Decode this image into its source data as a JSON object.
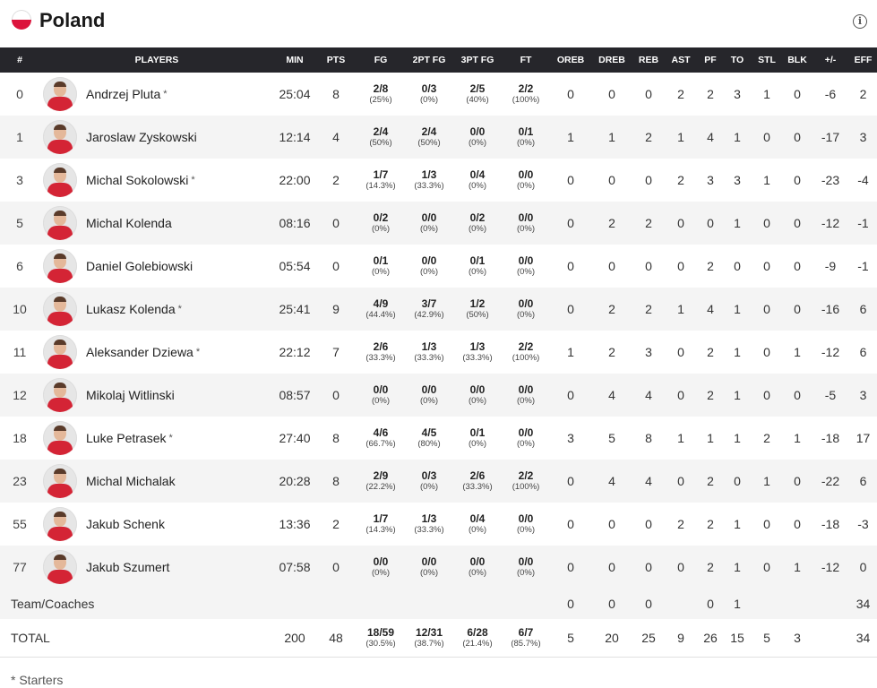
{
  "team_name": "Poland",
  "flag_colors": {
    "top": "#ffffff",
    "bottom": "#dc143c"
  },
  "info_icon": "i",
  "columns": [
    "#",
    "PLAYERS",
    "MIN",
    "PTS",
    "FG",
    "2PT FG",
    "3PT FG",
    "FT",
    "OREB",
    "DREB",
    "REB",
    "AST",
    "PF",
    "TO",
    "STL",
    "BLK",
    "+/-",
    "EFF"
  ],
  "players": [
    {
      "num": "0",
      "name": "Andrzej Pluta",
      "starter": "*",
      "min": "25:04",
      "pts": "8",
      "fg": "2/8",
      "fg_pct": "(25%)",
      "fg2": "0/3",
      "fg2_pct": "(0%)",
      "fg3": "2/5",
      "fg3_pct": "(40%)",
      "ft": "2/2",
      "ft_pct": "(100%)",
      "oreb": "0",
      "dreb": "0",
      "reb": "0",
      "ast": "2",
      "pf": "2",
      "to": "3",
      "stl": "1",
      "blk": "0",
      "pm": "-6",
      "eff": "2"
    },
    {
      "num": "1",
      "name": "Jaroslaw Zyskowski",
      "starter": "",
      "min": "12:14",
      "pts": "4",
      "fg": "2/4",
      "fg_pct": "(50%)",
      "fg2": "2/4",
      "fg2_pct": "(50%)",
      "fg3": "0/0",
      "fg3_pct": "(0%)",
      "ft": "0/1",
      "ft_pct": "(0%)",
      "oreb": "1",
      "dreb": "1",
      "reb": "2",
      "ast": "1",
      "pf": "4",
      "to": "1",
      "stl": "0",
      "blk": "0",
      "pm": "-17",
      "eff": "3"
    },
    {
      "num": "3",
      "name": "Michal Sokolowski",
      "starter": "*",
      "min": "22:00",
      "pts": "2",
      "fg": "1/7",
      "fg_pct": "(14.3%)",
      "fg2": "1/3",
      "fg2_pct": "(33.3%)",
      "fg3": "0/4",
      "fg3_pct": "(0%)",
      "ft": "0/0",
      "ft_pct": "(0%)",
      "oreb": "0",
      "dreb": "0",
      "reb": "0",
      "ast": "2",
      "pf": "3",
      "to": "3",
      "stl": "1",
      "blk": "0",
      "pm": "-23",
      "eff": "-4"
    },
    {
      "num": "5",
      "name": "Michal Kolenda",
      "starter": "",
      "min": "08:16",
      "pts": "0",
      "fg": "0/2",
      "fg_pct": "(0%)",
      "fg2": "0/0",
      "fg2_pct": "(0%)",
      "fg3": "0/2",
      "fg3_pct": "(0%)",
      "ft": "0/0",
      "ft_pct": "(0%)",
      "oreb": "0",
      "dreb": "2",
      "reb": "2",
      "ast": "0",
      "pf": "0",
      "to": "1",
      "stl": "0",
      "blk": "0",
      "pm": "-12",
      "eff": "-1"
    },
    {
      "num": "6",
      "name": "Daniel Golebiowski",
      "starter": "",
      "min": "05:54",
      "pts": "0",
      "fg": "0/1",
      "fg_pct": "(0%)",
      "fg2": "0/0",
      "fg2_pct": "(0%)",
      "fg3": "0/1",
      "fg3_pct": "(0%)",
      "ft": "0/0",
      "ft_pct": "(0%)",
      "oreb": "0",
      "dreb": "0",
      "reb": "0",
      "ast": "0",
      "pf": "2",
      "to": "0",
      "stl": "0",
      "blk": "0",
      "pm": "-9",
      "eff": "-1"
    },
    {
      "num": "10",
      "name": "Lukasz Kolenda",
      "starter": "*",
      "min": "25:41",
      "pts": "9",
      "fg": "4/9",
      "fg_pct": "(44.4%)",
      "fg2": "3/7",
      "fg2_pct": "(42.9%)",
      "fg3": "1/2",
      "fg3_pct": "(50%)",
      "ft": "0/0",
      "ft_pct": "(0%)",
      "oreb": "0",
      "dreb": "2",
      "reb": "2",
      "ast": "1",
      "pf": "4",
      "to": "1",
      "stl": "0",
      "blk": "0",
      "pm": "-16",
      "eff": "6"
    },
    {
      "num": "11",
      "name": "Aleksander Dziewa",
      "starter": "*",
      "min": "22:12",
      "pts": "7",
      "fg": "2/6",
      "fg_pct": "(33.3%)",
      "fg2": "1/3",
      "fg2_pct": "(33.3%)",
      "fg3": "1/3",
      "fg3_pct": "(33.3%)",
      "ft": "2/2",
      "ft_pct": "(100%)",
      "oreb": "1",
      "dreb": "2",
      "reb": "3",
      "ast": "0",
      "pf": "2",
      "to": "1",
      "stl": "0",
      "blk": "1",
      "pm": "-12",
      "eff": "6"
    },
    {
      "num": "12",
      "name": "Mikolaj Witlinski",
      "starter": "",
      "min": "08:57",
      "pts": "0",
      "fg": "0/0",
      "fg_pct": "(0%)",
      "fg2": "0/0",
      "fg2_pct": "(0%)",
      "fg3": "0/0",
      "fg3_pct": "(0%)",
      "ft": "0/0",
      "ft_pct": "(0%)",
      "oreb": "0",
      "dreb": "4",
      "reb": "4",
      "ast": "0",
      "pf": "2",
      "to": "1",
      "stl": "0",
      "blk": "0",
      "pm": "-5",
      "eff": "3"
    },
    {
      "num": "18",
      "name": "Luke Petrasek",
      "starter": "*",
      "min": "27:40",
      "pts": "8",
      "fg": "4/6",
      "fg_pct": "(66.7%)",
      "fg2": "4/5",
      "fg2_pct": "(80%)",
      "fg3": "0/1",
      "fg3_pct": "(0%)",
      "ft": "0/0",
      "ft_pct": "(0%)",
      "oreb": "3",
      "dreb": "5",
      "reb": "8",
      "ast": "1",
      "pf": "1",
      "to": "1",
      "stl": "2",
      "blk": "1",
      "pm": "-18",
      "eff": "17"
    },
    {
      "num": "23",
      "name": "Michal Michalak",
      "starter": "",
      "min": "20:28",
      "pts": "8",
      "fg": "2/9",
      "fg_pct": "(22.2%)",
      "fg2": "0/3",
      "fg2_pct": "(0%)",
      "fg3": "2/6",
      "fg3_pct": "(33.3%)",
      "ft": "2/2",
      "ft_pct": "(100%)",
      "oreb": "0",
      "dreb": "4",
      "reb": "4",
      "ast": "0",
      "pf": "2",
      "to": "0",
      "stl": "1",
      "blk": "0",
      "pm": "-22",
      "eff": "6"
    },
    {
      "num": "55",
      "name": "Jakub Schenk",
      "starter": "",
      "min": "13:36",
      "pts": "2",
      "fg": "1/7",
      "fg_pct": "(14.3%)",
      "fg2": "1/3",
      "fg2_pct": "(33.3%)",
      "fg3": "0/4",
      "fg3_pct": "(0%)",
      "ft": "0/0",
      "ft_pct": "(0%)",
      "oreb": "0",
      "dreb": "0",
      "reb": "0",
      "ast": "2",
      "pf": "2",
      "to": "1",
      "stl": "0",
      "blk": "0",
      "pm": "-18",
      "eff": "-3"
    },
    {
      "num": "77",
      "name": "Jakub Szumert",
      "starter": "",
      "min": "07:58",
      "pts": "0",
      "fg": "0/0",
      "fg_pct": "(0%)",
      "fg2": "0/0",
      "fg2_pct": "(0%)",
      "fg3": "0/0",
      "fg3_pct": "(0%)",
      "ft": "0/0",
      "ft_pct": "(0%)",
      "oreb": "0",
      "dreb": "0",
      "reb": "0",
      "ast": "0",
      "pf": "2",
      "to": "1",
      "stl": "0",
      "blk": "1",
      "pm": "-12",
      "eff": "0"
    }
  ],
  "team_row": {
    "label": "Team/Coaches",
    "oreb": "0",
    "dreb": "0",
    "reb": "0",
    "pf": "0",
    "to": "1",
    "eff": "34"
  },
  "total_row": {
    "label": "TOTAL",
    "min": "200",
    "pts": "48",
    "fg": "18/59",
    "fg_pct": "(30.5%)",
    "fg2": "12/31",
    "fg2_pct": "(38.7%)",
    "fg3": "6/28",
    "fg3_pct": "(21.4%)",
    "ft": "6/7",
    "ft_pct": "(85.7%)",
    "oreb": "5",
    "dreb": "20",
    "reb": "25",
    "ast": "9",
    "pf": "26",
    "to": "15",
    "stl": "5",
    "blk": "3",
    "eff": "34"
  },
  "footnote": "* Starters"
}
